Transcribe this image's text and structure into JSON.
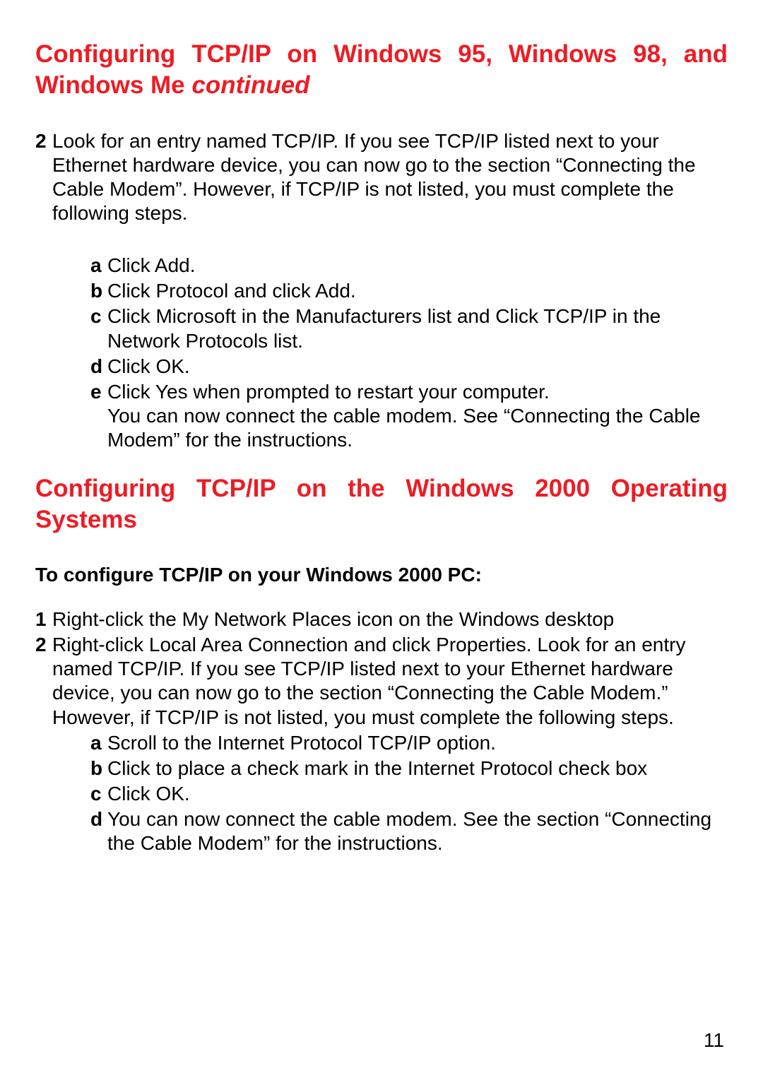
{
  "heading1": {
    "main": "Configuring TCP/IP on Windows 95, Windows 98, and Windows Me ",
    "continued": "continued"
  },
  "step2": {
    "num": "2",
    "text": "Look for an entry named TCP/IP. If you see TCP/IP listed next to your Ethernet hardware device, you can now go to the section “Connecting the Cable Modem”. However, if TCP/IP is not listed, you must complete the following steps."
  },
  "sublistA": {
    "a": {
      "l": "a",
      "t": "Click Add."
    },
    "b": {
      "l": "b",
      "t": "Click Protocol and click Add."
    },
    "c": {
      "l": "c",
      "t": "Click Microsoft in the Manufacturers list and Click TCP/IP in the Network Protocols list."
    },
    "d": {
      "l": "d",
      "t": "Click OK."
    },
    "e": {
      "l": "e",
      "t1": "Click Yes when prompted to restart your computer.",
      "t2": "You can now connect the cable modem. See “Connecting the Cable Modem” for the instructions."
    }
  },
  "heading2": "Configuring TCP/IP on the Windows 2000 Operating Systems",
  "subhead2": "To configure TCP/IP on your Windows 2000 PC:",
  "stepsB": {
    "s1": {
      "num": "1",
      "t": "Right-click the My Network Places icon on the Windows desktop"
    },
    "s2": {
      "num": "2",
      "t": "Right-click Local Area Connection and click Properties. Look for an entry named TCP/IP. If you see TCP/IP listed next to your Ethernet hardware device, you can now go to the section “Connecting the Cable Modem.” However, if TCP/IP is not listed, you must complete the following steps."
    }
  },
  "sublistB": {
    "a": {
      "l": "a",
      "t": "Scroll to the Internet Protocol TCP/IP option."
    },
    "b": {
      "l": "b",
      "t": "Click to place a check mark in the Internet Protocol check box"
    },
    "c": {
      "l": "c",
      "t": "Click OK."
    },
    "d": {
      "l": "d",
      "t": "You can now connect the cable modem. See the section “Connecting the Cable Modem” for the instructions."
    }
  },
  "pageNumber": "11"
}
